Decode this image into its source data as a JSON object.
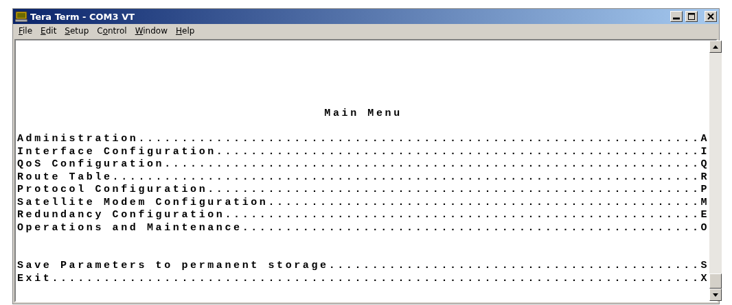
{
  "window": {
    "title": "Tera Term - COM3 VT"
  },
  "menu_bar": [
    "File",
    "Edit",
    "Setup",
    "Control",
    "Window",
    "Help"
  ],
  "terminal": {
    "heading": "Main Menu",
    "menu_lines": [
      "Administration.................................................................A",
      "Interface Configuration........................................................I",
      "QoS Configuration..............................................................Q",
      "Route Table....................................................................R",
      "Protocol Configuration.........................................................P",
      "Satellite Modem Configuration..................................................M",
      "Redundancy Configuration.......................................................E",
      "Operations and Maintenance.....................................................O"
    ],
    "action_lines": [
      "Save Parameters to permanent storage...........................................S",
      "Exit...........................................................................X"
    ]
  }
}
